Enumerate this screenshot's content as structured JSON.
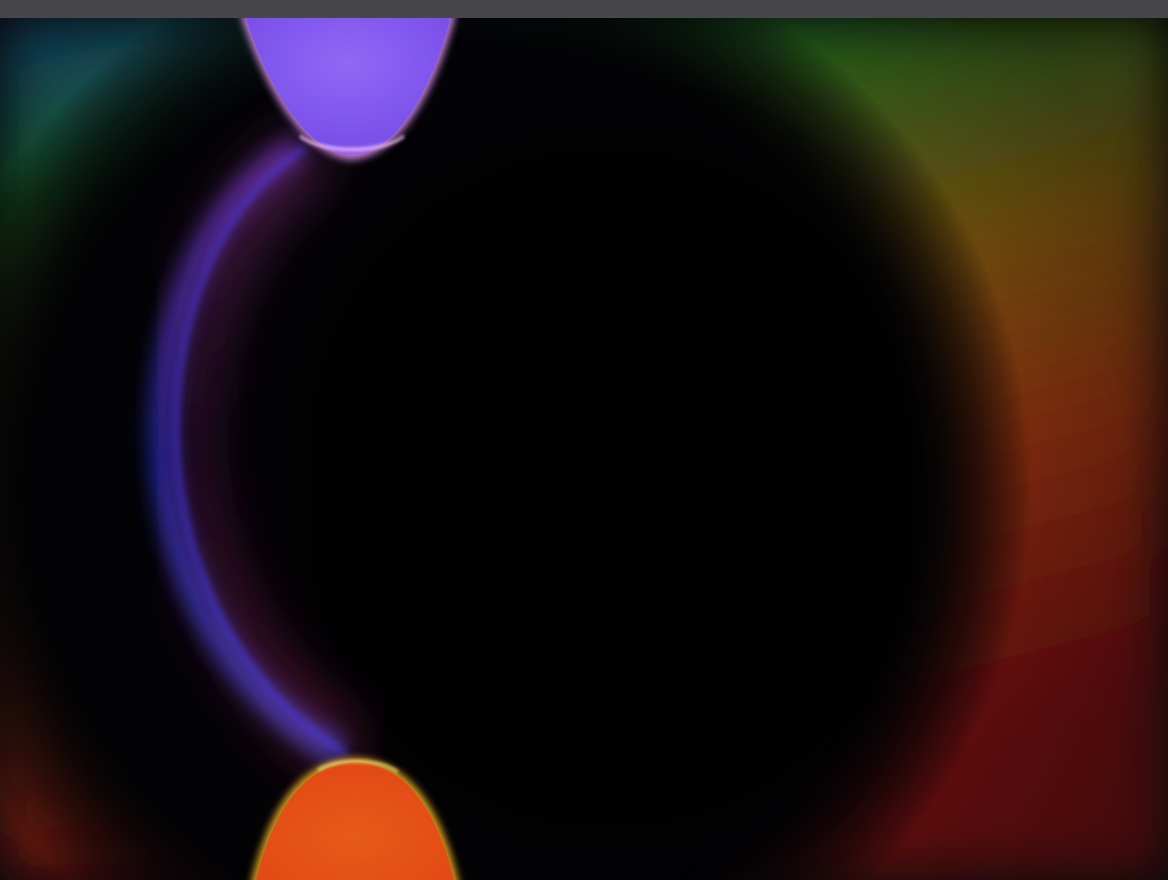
{
  "screen": {
    "content": "abstract-wallpaper",
    "colors": {
      "background": "#030305",
      "top_bar": "#47464b",
      "violet_shape": "#8a5cf0",
      "orange_shape": "#e0501a",
      "blue_arc": "#3340e0",
      "magenta_arc": "#a0307a",
      "green_glow": "#1b5a1b",
      "orange_glow": "#8a4010",
      "red_glow": "#7a1010"
    }
  }
}
